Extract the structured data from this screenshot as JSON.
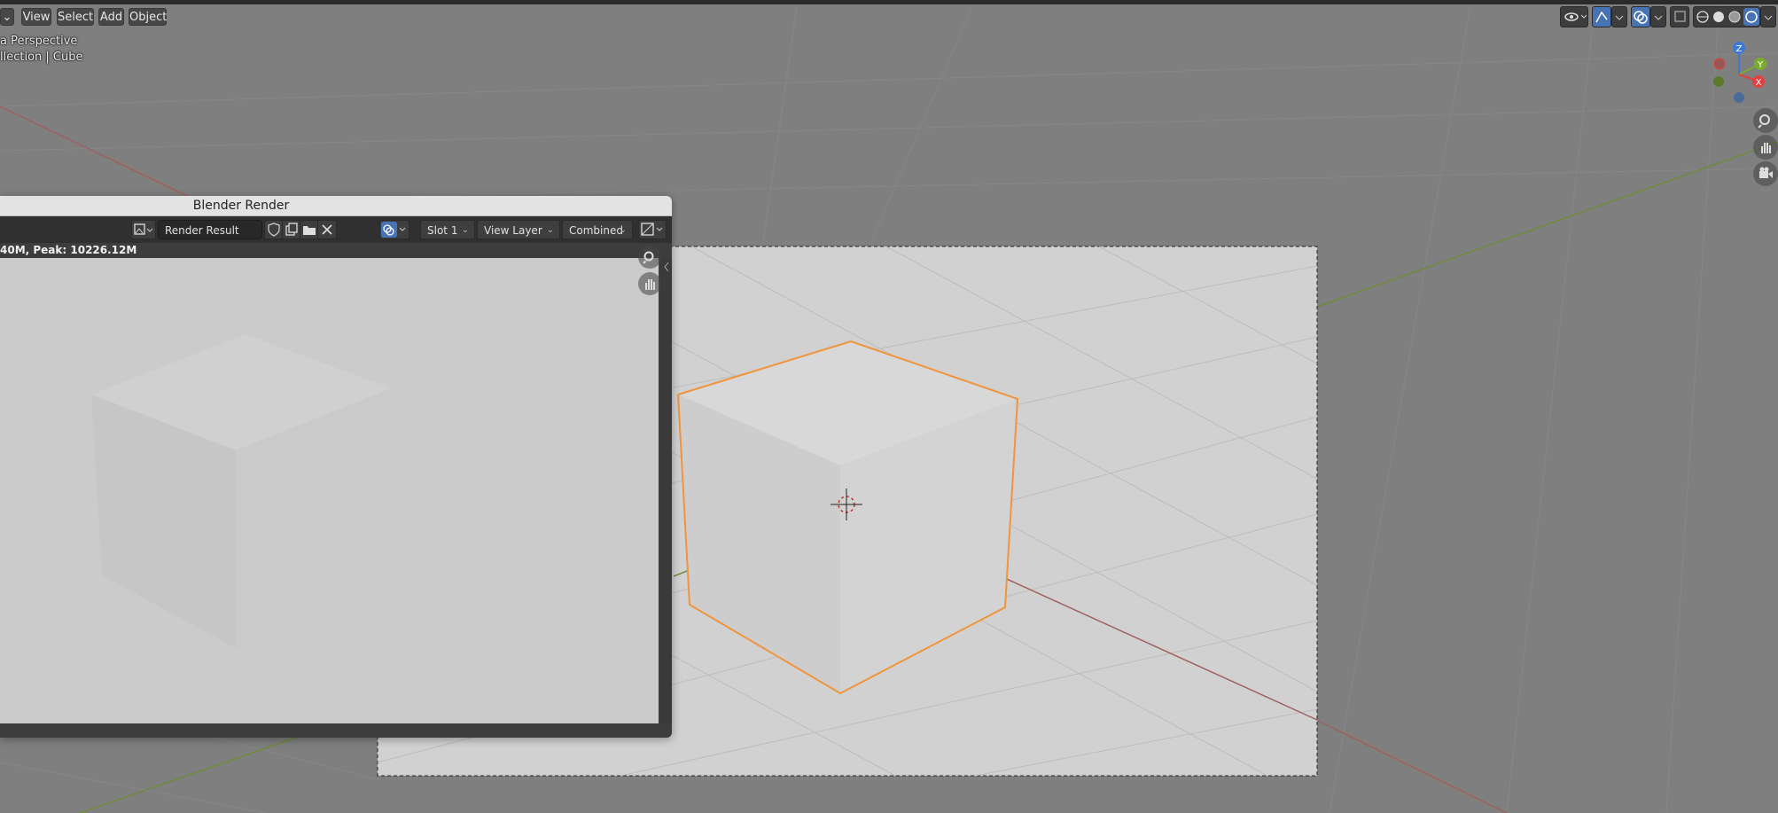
{
  "viewport": {
    "header_menus": [
      "View",
      "Select",
      "Add",
      "Object"
    ],
    "overlay_line1": "a Perspective",
    "overlay_line2": "llection | Cube",
    "gizmo_axes": [
      "Z",
      "Y",
      "X"
    ],
    "colors": {
      "background": "#7f7f7f",
      "selection": "#f0953c",
      "x_axis": "#a65a5a",
      "y_axis": "#6e8a3a"
    }
  },
  "render_window": {
    "title": "Blender Render",
    "image_name": "Render Result",
    "slot": "Slot 1",
    "view_layer": "View Layer",
    "pass": "Combined",
    "stats": "40M, Peak: 10226.12M"
  }
}
